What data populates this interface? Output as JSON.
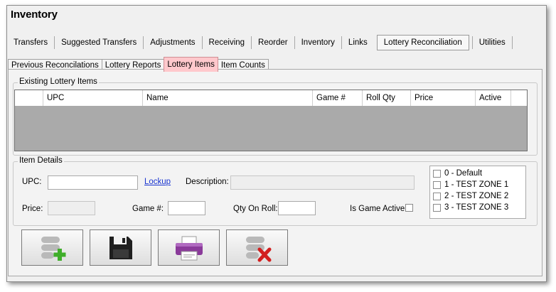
{
  "window": {
    "title": "Inventory"
  },
  "main_tabs": [
    {
      "label": "Transfers"
    },
    {
      "label": "Suggested Transfers"
    },
    {
      "label": "Adjustments"
    },
    {
      "label": "Receiving"
    },
    {
      "label": "Reorder"
    },
    {
      "label": "Inventory"
    },
    {
      "label": "Links"
    },
    {
      "label": "Lottery Reconciliation",
      "active": true
    },
    {
      "label": "Utilities"
    }
  ],
  "sub_tabs": [
    {
      "label": "Previous Reconcilations"
    },
    {
      "label": "Lottery Reports"
    },
    {
      "label": "Lottery Items",
      "active": true
    },
    {
      "label": "Item Counts"
    }
  ],
  "existing_items": {
    "group_label": "Existing Lottery Items",
    "columns": [
      "UPC",
      "Name",
      "Game #",
      "Roll Qty",
      "Price",
      "Active"
    ],
    "rows": []
  },
  "item_details": {
    "group_label": "Item Details",
    "upc_label": "UPC:",
    "upc_value": "",
    "lookup_label": "Lockup",
    "description_label": "Description:",
    "description_value": "",
    "price_label": "Price:",
    "price_value": "",
    "game_label": "Game #:",
    "game_value": "",
    "qty_label": "Qty On Roll:",
    "qty_value": "",
    "active_label": "Is Game Active",
    "active_checked": false
  },
  "zones": [
    {
      "label": "0 - Default",
      "checked": false
    },
    {
      "label": "1 - TEST ZONE 1",
      "checked": false
    },
    {
      "label": "2 - TEST ZONE 2",
      "checked": false
    },
    {
      "label": "3 - TEST ZONE 3",
      "checked": false
    }
  ],
  "toolbar": [
    {
      "icon": "add-item-icon"
    },
    {
      "icon": "save-disk-icon"
    },
    {
      "icon": "printer-icon"
    },
    {
      "icon": "delete-item-icon"
    }
  ],
  "colors": {
    "active_subtab": "#ffc8cc",
    "grid_background": "#aaaaaa",
    "add_accent": "#3fae2a",
    "delete_accent": "#d21f1f",
    "printer_accent": "#8a3a9a",
    "link": "#1a35d0"
  }
}
